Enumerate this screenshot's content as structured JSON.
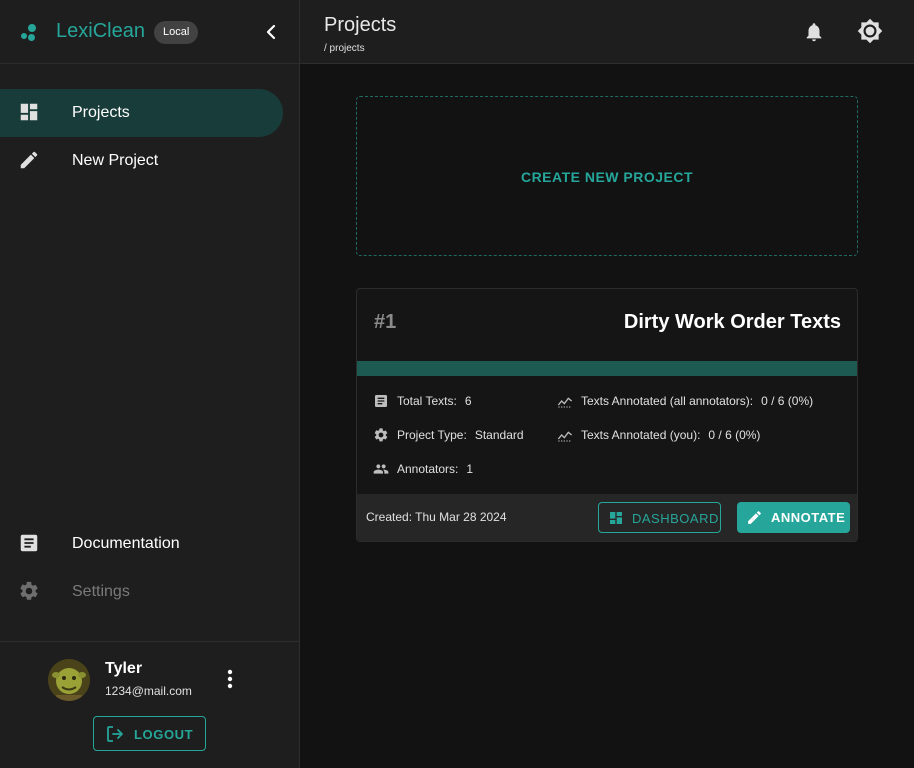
{
  "app": {
    "brand": "LexiClean",
    "badge": "Local",
    "colors": {
      "accent": "#26a69a",
      "accent_dark": "#183c39",
      "background": "#121212",
      "surface": "#1e1e1e"
    }
  },
  "sidebar": {
    "items": [
      {
        "label": "Projects",
        "icon": "dashboard-icon",
        "active": true
      },
      {
        "label": "New Project",
        "icon": "pencil-icon",
        "active": false
      }
    ],
    "bottom_items": [
      {
        "label": "Documentation",
        "icon": "article-icon"
      },
      {
        "label": "Settings",
        "icon": "gear-icon"
      }
    ],
    "user": {
      "name": "Tyler",
      "email": "1234@mail.com"
    },
    "logout_label": "LOGOUT"
  },
  "header": {
    "title": "Projects",
    "breadcrumb": "/ projects"
  },
  "main": {
    "create_label": "CREATE NEW PROJECT",
    "project": {
      "number": "#1",
      "name": "Dirty Work Order Texts",
      "progress": 0,
      "stats": {
        "total_texts_label": "Total Texts:",
        "total_texts": "6",
        "project_type_label": "Project Type:",
        "project_type": "Standard",
        "annotators_label": "Annotators:",
        "annotators": "1",
        "annotated_all_label": "Texts Annotated (all annotators):",
        "annotated_all": "0 / 6 (0%)",
        "annotated_you_label": "Texts Annotated (you):",
        "annotated_you": "0 / 6 (0%)"
      },
      "created": "Created: Thu Mar 28 2024",
      "dashboard_label": "DASHBOARD",
      "annotate_label": "ANNOTATE"
    }
  }
}
